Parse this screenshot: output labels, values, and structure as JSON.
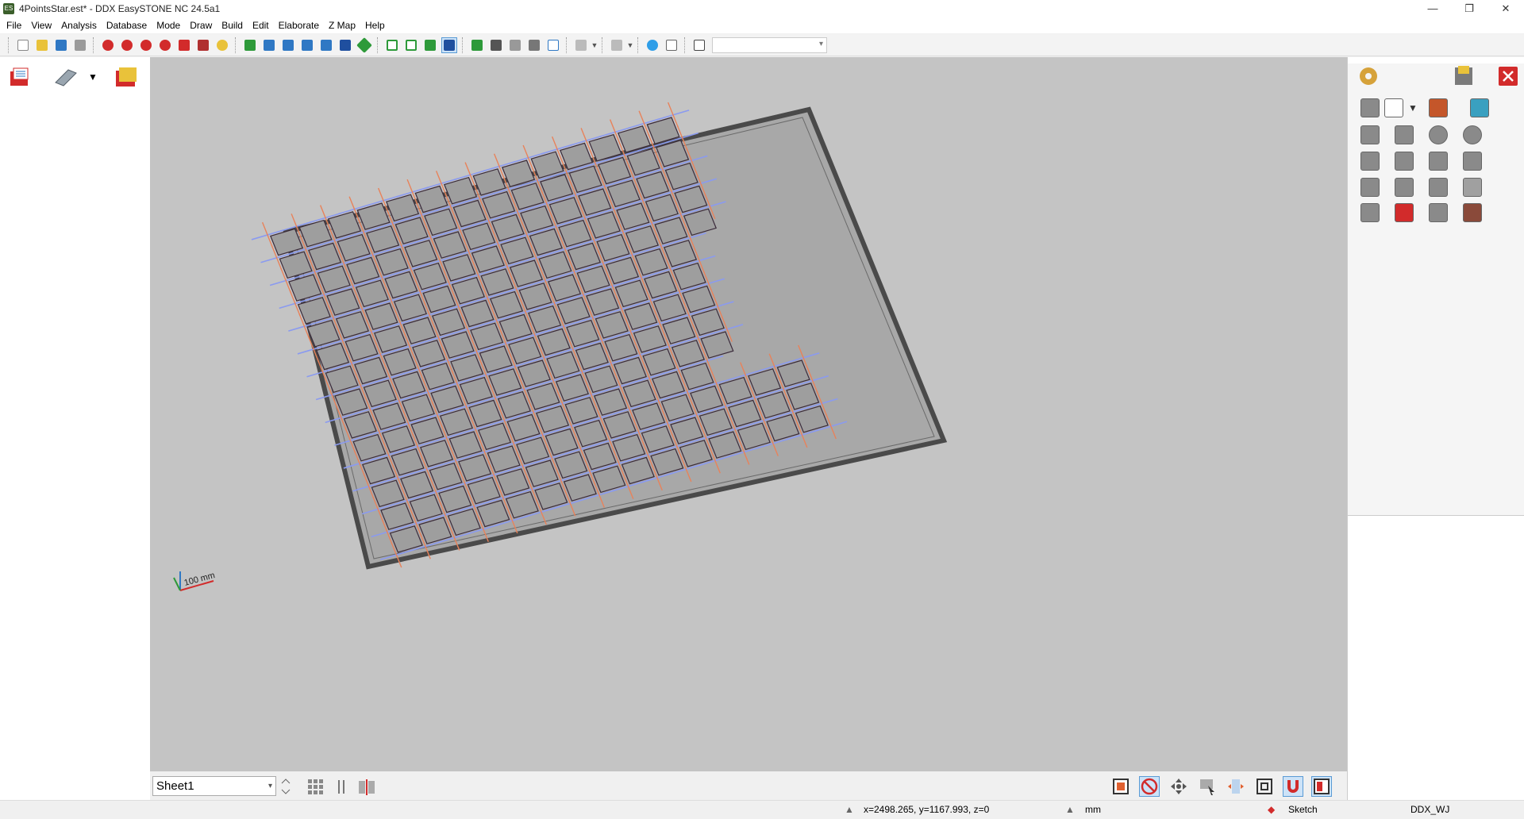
{
  "window": {
    "title": "4PointsStar.est* - DDX EasySTONE NC 24.5a1",
    "app_icon_text": "ES",
    "minimize": "—",
    "restore": "❐",
    "close": "✕"
  },
  "menu": [
    "File",
    "View",
    "Analysis",
    "Database",
    "Mode",
    "Draw",
    "Build",
    "Edit",
    "Elaborate",
    "Z Map",
    "Help"
  ],
  "toolbar": {
    "combo_value": "",
    "icons": [
      "new-icon",
      "open-icon",
      "save-icon",
      "print-icon",
      "zoom-icon",
      "zoom-window-icon",
      "zoom-out-icon",
      "zoom-in-icon",
      "pan-icon",
      "measure-icon",
      "light-icon",
      "view-front-icon",
      "view-back-icon",
      "view-left-icon",
      "view-right-icon",
      "view-top-icon",
      "view-iso-icon",
      "view-axis-icon",
      "shade-wire-icon",
      "shade-hidden-icon",
      "shade-solid-icon",
      "shade-render-icon",
      "fit-icon",
      "camera-icon",
      "tool-icon",
      "pointer-icon",
      "doc-icon",
      "undo-icon",
      "redo-icon",
      "user-icon",
      "mail-icon",
      "clipboard-icon"
    ],
    "colors": {
      "blue": "#2f78c4",
      "green": "#2e9a3a",
      "yellow": "#e9c23a",
      "red": "#d22b2b"
    }
  },
  "viewport": {
    "background": "#c4c4c4",
    "plate_fill": "#a8a8a8",
    "frame_color": "#4a4a4a",
    "tile_fill": "#9e9e9e",
    "star_color": "#7a5a8a",
    "accent_orange": "#e8825a",
    "accent_blue": "#8a9af0",
    "scale_label": "100 mm"
  },
  "bottom": {
    "sheet": "Sheet1"
  },
  "status": {
    "coords": "x=2498.265, y=1167.993, z=0",
    "units": "mm",
    "mode": "Sketch",
    "machine": "DDX_WJ"
  }
}
